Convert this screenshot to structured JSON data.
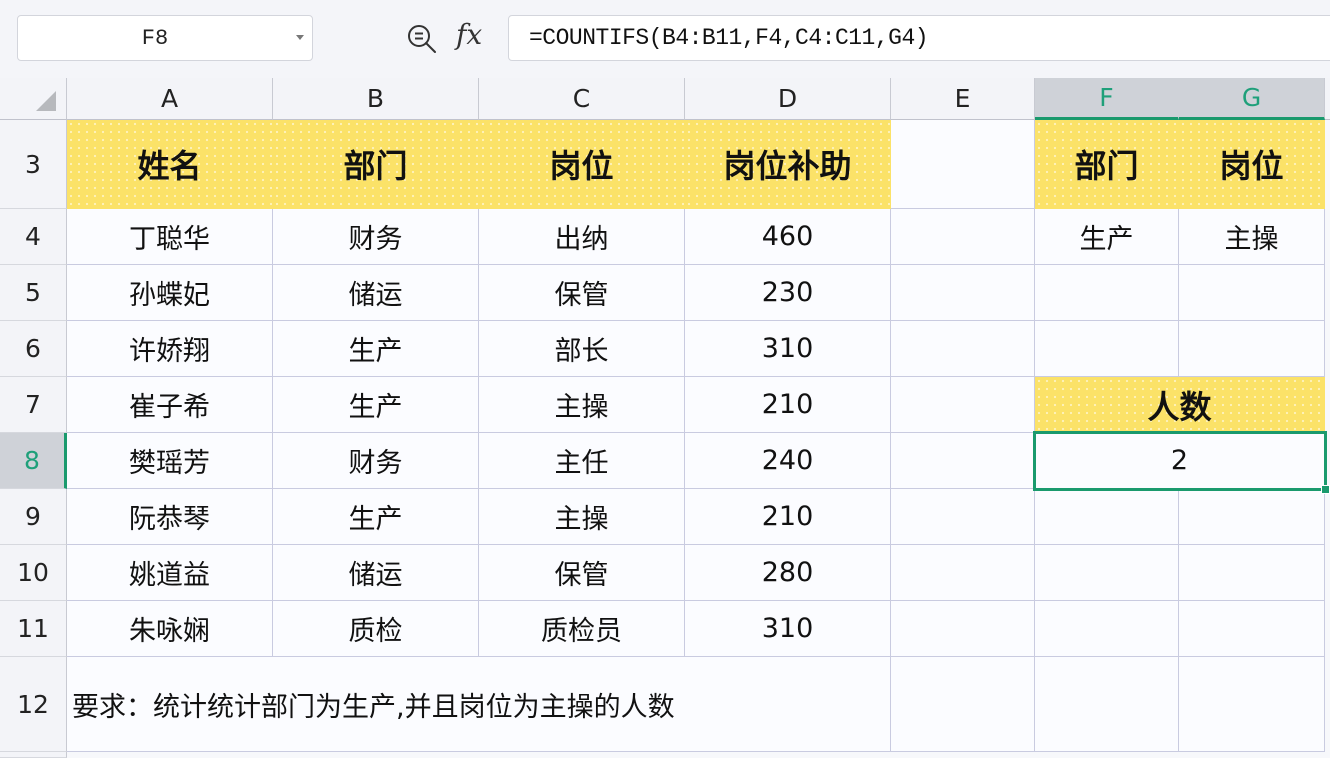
{
  "toolbar": {
    "name_box": "F8",
    "zoom_icon": "zoom-formula-icon",
    "fx_label": "fx",
    "formula": "=COUNTIFS(B4:B11,F4,C4:C11,G4)"
  },
  "columns": [
    "A",
    "B",
    "C",
    "D",
    "E",
    "F",
    "G"
  ],
  "selected_column": [
    "F",
    "G"
  ],
  "rows": [
    "3",
    "4",
    "5",
    "6",
    "7",
    "8",
    "9",
    "10",
    "11",
    "12"
  ],
  "selected_row": "8",
  "table": {
    "headers": [
      "姓名",
      "部门",
      "岗位",
      "岗位补助"
    ],
    "records": [
      [
        "丁聪华",
        "财务",
        "出纳",
        "460"
      ],
      [
        "孙蝶妃",
        "储运",
        "保管",
        "230"
      ],
      [
        "许娇翔",
        "生产",
        "部长",
        "310"
      ],
      [
        "崔子希",
        "生产",
        "主操",
        "210"
      ],
      [
        "樊瑶芳",
        "财务",
        "主任",
        "240"
      ],
      [
        "阮恭琴",
        "生产",
        "主操",
        "210"
      ],
      [
        "姚道益",
        "储运",
        "保管",
        "280"
      ],
      [
        "朱咏娴",
        "质检",
        "质检员",
        "310"
      ]
    ]
  },
  "criteria": {
    "headers": [
      "部门",
      "岗位"
    ],
    "values": [
      "生产",
      "主操"
    ]
  },
  "result": {
    "label": "人数",
    "value": "2"
  },
  "note": "要求：统计统计部门为生产,并且岗位为主操的人数",
  "colors": {
    "header_fill": "#fbe268",
    "selection_green": "#1a9a6d"
  }
}
